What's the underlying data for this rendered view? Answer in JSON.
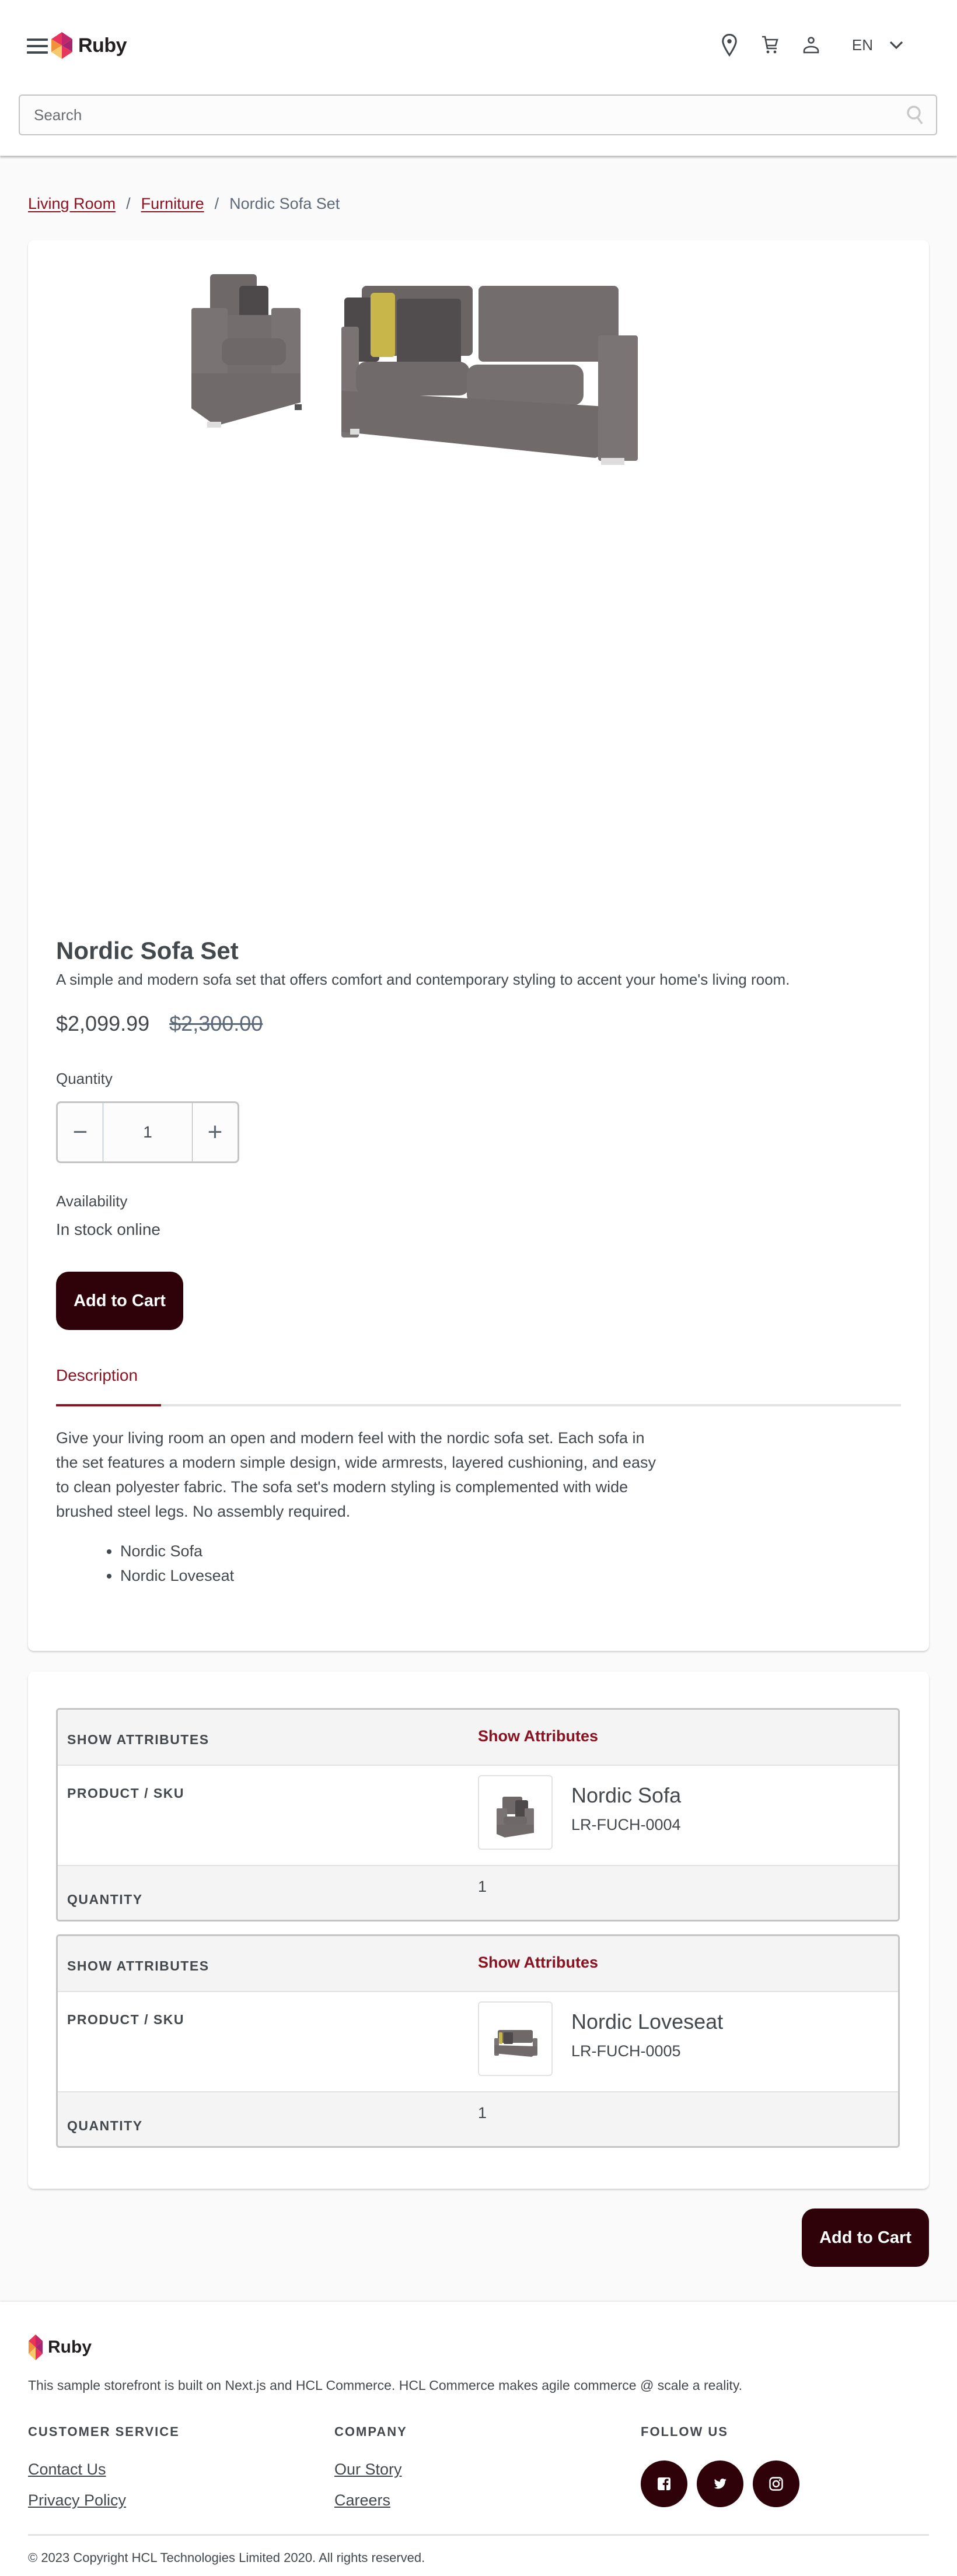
{
  "header": {
    "brand": "Ruby",
    "language": "EN",
    "search_placeholder": "Search",
    "icons": [
      "menu-icon",
      "location-icon",
      "cart-icon",
      "account-icon",
      "chevron-down-icon",
      "search-icon"
    ]
  },
  "breadcrumb": {
    "items": [
      {
        "label": "Living Room",
        "link": true
      },
      {
        "label": "Furniture",
        "link": true
      },
      {
        "label": "Nordic Sofa Set",
        "link": false
      }
    ],
    "separator": "/"
  },
  "product": {
    "title": "Nordic Sofa Set",
    "short_description": "A simple and modern sofa set that offers comfort and contemporary styling to accent your home's living room.",
    "price": "$2,099.99",
    "list_price": "$2,300.00",
    "quantity_label": "Quantity",
    "quantity_value": "1",
    "decrement_label": "−",
    "increment_label": "+",
    "availability_label": "Availability",
    "availability_value": "In stock online",
    "add_to_cart_label": "Add to Cart",
    "tabs": [
      {
        "label": "Description",
        "active": true
      }
    ],
    "long_description": "Give your living room an open and modern feel with the nordic sofa set. Each sofa in the set features a modern simple design, wide armrests, layered cushioning, and easy to clean polyester fabric. The sofa set's modern styling is complemented with wide brushed steel legs. No assembly required.",
    "includes": [
      "Nordic Sofa",
      "Nordic Loveseat"
    ]
  },
  "components": {
    "headers": {
      "attributes": "SHOW ATTRIBUTES",
      "product_sku": "PRODUCT / SKU",
      "quantity": "QUANTITY"
    },
    "show_attributes_label": "Show Attributes",
    "items": [
      {
        "name": "Nordic Sofa",
        "sku": "LR-FUCH-0004",
        "quantity": "1"
      },
      {
        "name": "Nordic Loveseat",
        "sku": "LR-FUCH-0005",
        "quantity": "1"
      }
    ],
    "add_to_cart_label": "Add to Cart"
  },
  "footer": {
    "brand": "Ruby",
    "tagline": "This sample storefront is built on Next.js and HCL Commerce. HCL Commerce makes agile commerce @ scale a reality.",
    "columns": [
      {
        "title": "CUSTOMER SERVICE",
        "links": [
          "Contact Us",
          "Privacy Policy"
        ]
      },
      {
        "title": "COMPANY",
        "links": [
          "Our Story",
          "Careers"
        ]
      },
      {
        "title": "FOLLOW US",
        "social": [
          "facebook-icon",
          "twitter-icon",
          "instagram-icon"
        ]
      }
    ],
    "copyright": "© 2023 Copyright HCL Technologies Limited 2020. All rights reserved."
  },
  "colors": {
    "accent": "#8b1220",
    "button": "#2f0209",
    "text": "#43484d",
    "muted": "#5e6977"
  }
}
